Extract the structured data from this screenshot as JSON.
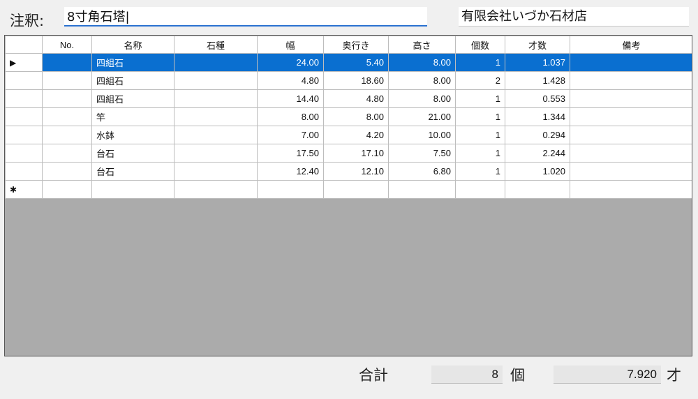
{
  "memo": {
    "label": "注釈:",
    "value": "8寸角石塔|"
  },
  "company": "有限会社いづか石材店",
  "columns": [
    "",
    "No.",
    "名称",
    "石種",
    "幅",
    "奥行き",
    "高さ",
    "個数",
    "才数",
    "備考"
  ],
  "rows": [
    {
      "marker": "▶",
      "no": "",
      "name": "四組石",
      "stone": "",
      "width": "24.00",
      "depth": "5.40",
      "height": "8.00",
      "qty": "1",
      "sai": "1.037",
      "note": ""
    },
    {
      "marker": "",
      "no": "",
      "name": "四組石",
      "stone": "",
      "width": "4.80",
      "depth": "18.60",
      "height": "8.00",
      "qty": "2",
      "sai": "1.428",
      "note": ""
    },
    {
      "marker": "",
      "no": "",
      "name": "四組石",
      "stone": "",
      "width": "14.40",
      "depth": "4.80",
      "height": "8.00",
      "qty": "1",
      "sai": "0.553",
      "note": ""
    },
    {
      "marker": "",
      "no": "",
      "name": "竿",
      "stone": "",
      "width": "8.00",
      "depth": "8.00",
      "height": "21.00",
      "qty": "1",
      "sai": "1.344",
      "note": ""
    },
    {
      "marker": "",
      "no": "",
      "name": "水鉢",
      "stone": "",
      "width": "7.00",
      "depth": "4.20",
      "height": "10.00",
      "qty": "1",
      "sai": "0.294",
      "note": ""
    },
    {
      "marker": "",
      "no": "",
      "name": "台石",
      "stone": "",
      "width": "17.50",
      "depth": "17.10",
      "height": "7.50",
      "qty": "1",
      "sai": "2.244",
      "note": ""
    },
    {
      "marker": "",
      "no": "",
      "name": "台石",
      "stone": "",
      "width": "12.40",
      "depth": "12.10",
      "height": "6.80",
      "qty": "1",
      "sai": "1.020",
      "note": ""
    }
  ],
  "new_row_marker": "✱",
  "totals": {
    "label": "合計",
    "count": "8",
    "count_unit": "個",
    "sai": "7.920",
    "sai_unit": "才"
  },
  "colors": {
    "selection": "#0a6fd0",
    "grid_empty": "#ababab"
  }
}
